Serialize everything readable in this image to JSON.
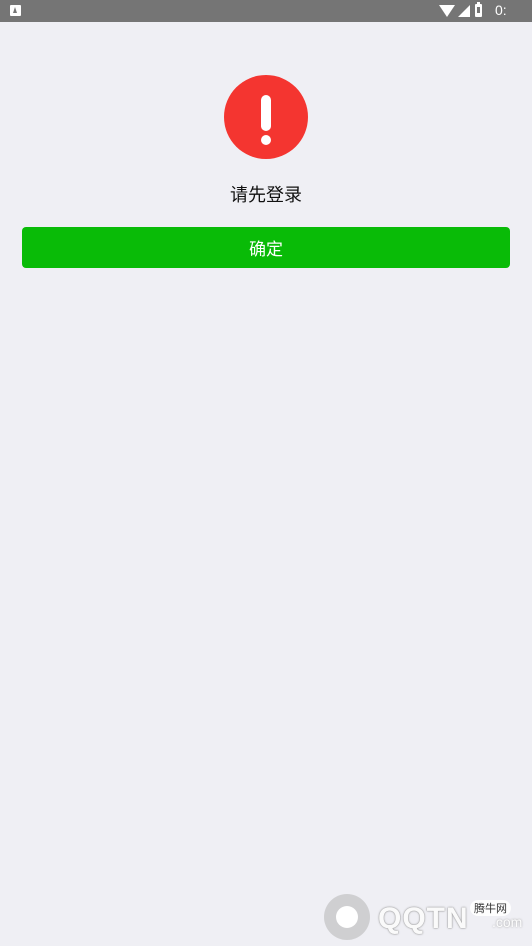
{
  "status_bar": {
    "time": "0:",
    "icons": [
      "app-notification-icon",
      "wifi-icon",
      "signal-icon",
      "battery-icon"
    ]
  },
  "alert": {
    "icon": "exclamation-icon",
    "color": "#f43530",
    "message": "请先登录"
  },
  "actions": {
    "confirm_label": "确定",
    "confirm_color": "#09bb07"
  },
  "watermark": {
    "brand": "QQTN",
    "domain_suffix": ".com",
    "tag": "腾牛网"
  }
}
